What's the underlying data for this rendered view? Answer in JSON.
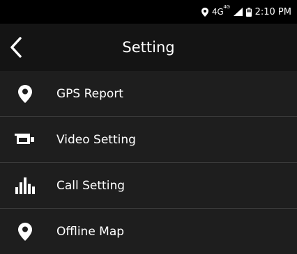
{
  "status_bar": {
    "network": "4G",
    "network_sup": "4G",
    "time": "2:10 PM",
    "icons": [
      "location-icon",
      "signal-icon",
      "battery-icon"
    ]
  },
  "header": {
    "title": "Setting",
    "back_icon": "chevron-left-icon"
  },
  "settings": {
    "items": [
      {
        "label": "GPS Report",
        "icon": "map-pin-icon"
      },
      {
        "label": "Video Setting",
        "icon": "video-camera-icon"
      },
      {
        "label": "Call Setting",
        "icon": "equalizer-icon"
      },
      {
        "label": "Offline Map",
        "icon": "map-pin-icon"
      }
    ]
  },
  "colors": {
    "background": "#1e1e1e",
    "header_background": "#141414",
    "status_background": "#000000",
    "divider": "#3a3a3a",
    "text": "#ffffff"
  }
}
